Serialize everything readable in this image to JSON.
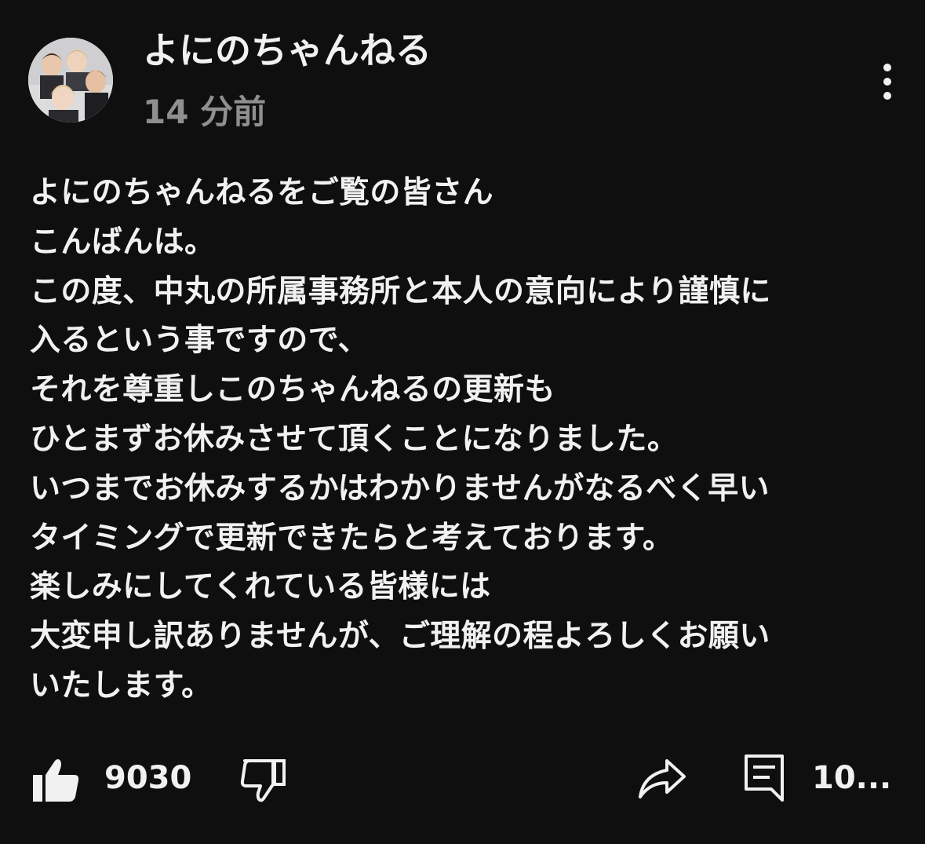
{
  "post": {
    "channel_name": "よにのちゃんねる",
    "time_ago": "14 分前",
    "body_lines": [
      "よにのちゃんねるをご覧の皆さん",
      "こんばんは。",
      "この度、中丸の所属事務所と本人の意向により謹慎に",
      "入るという事ですので、",
      "それを尊重しこのちゃんねるの更新も",
      "ひとまずお休みさせて頂くことになりました。",
      "いつまでお休みするかはわかりませんがなるべく早い",
      "タイミングで更新できたらと考えております。",
      "楽しみにしてくれている皆様には",
      "大変申し訳ありませんが、ご理解の程よろしくお願い",
      "いたします。"
    ]
  },
  "actions": {
    "like_icon": "thumbs-up-icon",
    "like_count": "9030",
    "dislike_icon": "thumbs-down-icon",
    "share_icon": "share-icon",
    "comment_icon": "comment-icon",
    "comment_count": "10..."
  },
  "colors": {
    "background": "#0f0f0f",
    "text_primary": "#f1f1f1",
    "text_secondary": "#8f8f8f"
  }
}
